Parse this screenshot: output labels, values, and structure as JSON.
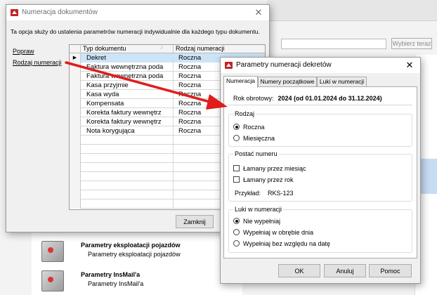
{
  "background": {
    "search_button": "Wybierz teraz",
    "items": [
      {
        "title": "Parametry eksploatacji pojazdów",
        "subtitle": "Parametry eksploatacji pojazdów"
      },
      {
        "title": "Parametry InsMail'a",
        "subtitle": "Parametry InsMail'a"
      }
    ]
  },
  "win1": {
    "title": "Numeracja dokumentów",
    "intro": "Ta opcja służy do ustalenia parametrów numeracji indywidualnie dla każdego typu dokumentu.",
    "link_edit": "Popraw",
    "link_kind": "Rodzaj numeracji",
    "col_type": "Typ dokumentu",
    "col_kind": "Rodzaj numeracji",
    "rows": [
      {
        "type": "Dekret",
        "kind": "Roczna"
      },
      {
        "type": "Faktura wewnętrzna poda",
        "kind": "Roczna"
      },
      {
        "type": "Faktura wewnętrzna poda",
        "kind": "Roczna"
      },
      {
        "type": "Kasa przyjmie",
        "kind": "Roczna"
      },
      {
        "type": "Kasa wyda",
        "kind": "Roczna"
      },
      {
        "type": "Kompensata",
        "kind": "Roczna"
      },
      {
        "type": "Korekta faktury wewnętrz",
        "kind": "Roczna"
      },
      {
        "type": "Korekta faktury wewnętrz",
        "kind": "Roczna"
      },
      {
        "type": "Nota korygująca",
        "kind": "Roczna"
      }
    ],
    "close_button": "Zamknij"
  },
  "win2": {
    "title": "Parametry numeracji dekretów",
    "tabs": [
      "Numeracja",
      "Numery początkowe",
      "Luki w numeracji"
    ],
    "year_label": "Rok obrotowy:",
    "year_value": "2024 (od 01.01.2024 do 31.12.2024)",
    "group_kind": "Rodzaj",
    "opt_yearly": "Roczna",
    "opt_monthly": "Miesięczna",
    "group_format": "Postać numeru",
    "chk_month": "Łamany przez miesiąc",
    "chk_year": "Łamany przez rok",
    "example_label": "Przykład:",
    "example_value": "RKS-123",
    "group_gaps": "Luki w numeracji",
    "gap_none": "Nie wypełniaj",
    "gap_day": "Wypełniaj w obrębie dnia",
    "gap_any": "Wypełniaj bez względu na datę",
    "ok_button": "OK",
    "cancel_button": "Anuluj",
    "help_button": "Pomoc"
  },
  "colors": {
    "arrow": "#e01c1c",
    "selection": "#cce4f7",
    "brand_icon": "#c42323"
  }
}
